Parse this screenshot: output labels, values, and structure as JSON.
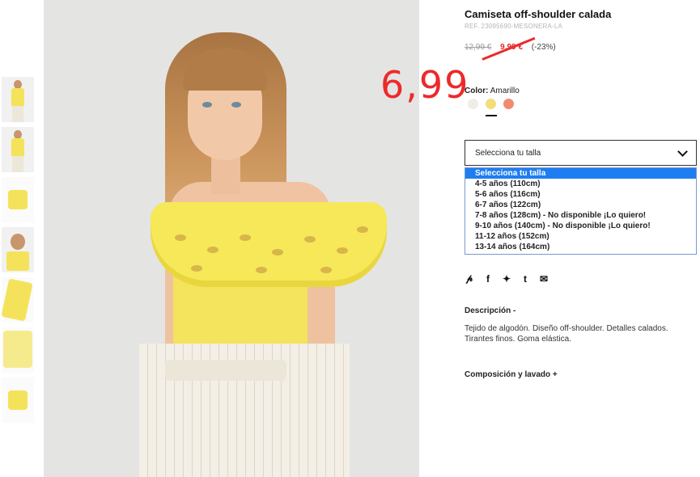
{
  "product": {
    "title": "Camiseta off-shoulder calada",
    "ref": "REF. 23095690-MESONERA-LA",
    "old_price": "12,99 €",
    "new_price": "9,99 €",
    "discount": "(-23%)",
    "handwritten_price": "6,99"
  },
  "color": {
    "label": "Color:",
    "value": "Amarillo",
    "swatches": [
      "#f0ede6",
      "#f3de7a",
      "#f28a72"
    ]
  },
  "size": {
    "select_label": "Selecciona tu talla",
    "options": [
      "Selecciona tu talla",
      "4-5 años (110cm)",
      "5-6 años (116cm)",
      "6-7 años (122cm)",
      "7-8 años (128cm) - No disponible ¡Lo quiero!",
      "9-10 años (140cm) - No disponible ¡Lo quiero!",
      "11-12 años (152cm)",
      "13-14 años (164cm)"
    ]
  },
  "share_icons": [
    "pinterest-icon",
    "facebook-icon",
    "twitter-icon",
    "tumblr-icon",
    "email-icon"
  ],
  "share_glyphs": [
    "℗",
    "f",
    "🐦",
    "t",
    "✉"
  ],
  "description": {
    "title": "Descripción -",
    "text": "Tejido de algodón. Diseño off-shoulder. Detalles calados. Tirantes finos. Goma elástica."
  },
  "composition": {
    "title": "Composición y lavado +"
  },
  "colors": {
    "accent_red": "#e3262d",
    "dropdown_selected": "#1e7df0"
  }
}
